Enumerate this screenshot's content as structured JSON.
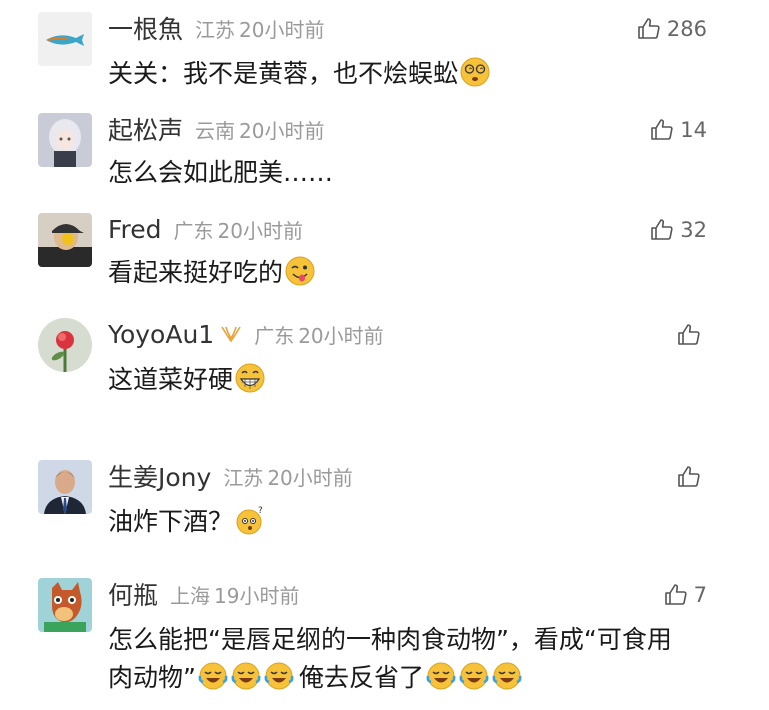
{
  "comments": [
    {
      "username": "一根魚",
      "location": "江苏",
      "time": "20小时前",
      "likes": "286",
      "text": "关关：我不是黄蓉，也不烩蜈蚣",
      "emojis": [
        "dizzy-face-emoji"
      ],
      "avatar": "fish-avatar"
    },
    {
      "username": "起松声",
      "location": "云南",
      "time": "20小时前",
      "likes": "14",
      "text": "怎么会如此肥美……",
      "emojis": [],
      "avatar": "anime-girl-avatar"
    },
    {
      "username": "Fred",
      "location": "广东",
      "time": "20小时前",
      "likes": "32",
      "text": "看起来挺好吃的",
      "emojis": [
        "winking-tongue-emoji"
      ],
      "avatar": "cap-person-avatar"
    },
    {
      "username": "YoyoAu1",
      "location": "广东",
      "time": "20小时前",
      "likes": "",
      "text": "这道菜好硬",
      "emojis": [
        "grinning-emoji"
      ],
      "avatar": "flower-avatar",
      "badge": "vip-badge-icon"
    },
    {
      "username": "生姜Jony",
      "location": "江苏",
      "time": "20小时前",
      "likes": "",
      "text": "油炸下酒？",
      "emojis": [
        "confused-emoji"
      ],
      "avatar": "man-suit-avatar"
    },
    {
      "username": "何瓶",
      "location": "上海",
      "time": "19小时前",
      "likes": "7",
      "text": "怎么能把“是唇足纲的一种肉食动物”，看成“可食用",
      "text2": "肉动物”",
      "text3": "俺去反省了",
      "avatar": "horse-avatar"
    }
  ],
  "colors": {
    "username": "#333333",
    "meta": "#9a9a9a",
    "body": "#1a1a1a",
    "emoji": "#f5c23a"
  }
}
